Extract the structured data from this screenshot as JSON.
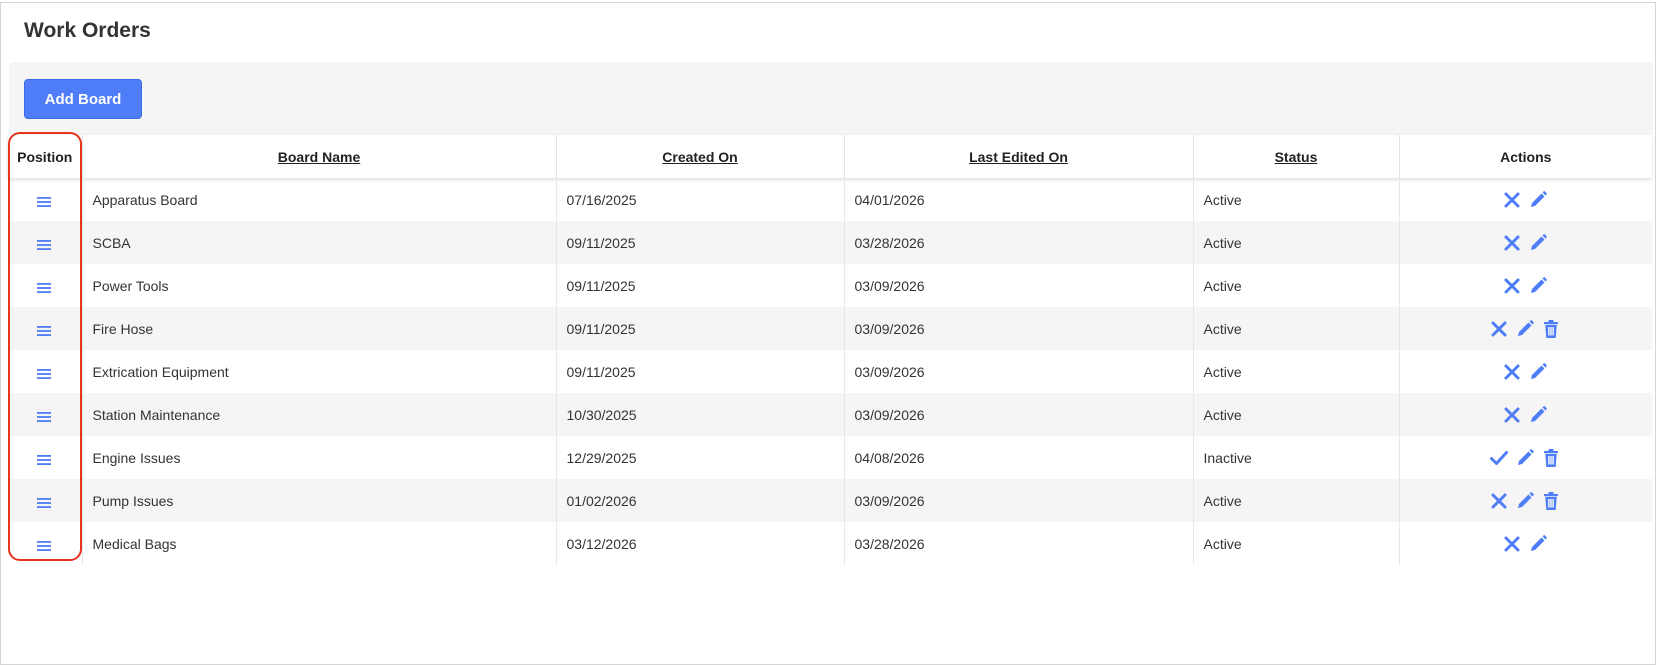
{
  "page": {
    "title": "Work Orders"
  },
  "toolbar": {
    "add_board_label": "Add Board"
  },
  "table": {
    "headers": {
      "position": "Position",
      "board_name": "Board Name",
      "created_on": "Created On",
      "last_edited_on": "Last Edited On",
      "status": "Status",
      "actions": "Actions"
    },
    "rows": [
      {
        "name": "Apparatus Board",
        "created": "07/16/2025",
        "edited": "04/01/2026",
        "status": "Active",
        "actions": [
          "deactivate",
          "edit"
        ]
      },
      {
        "name": "SCBA",
        "created": "09/11/2025",
        "edited": "03/28/2026",
        "status": "Active",
        "actions": [
          "deactivate",
          "edit"
        ]
      },
      {
        "name": "Power Tools",
        "created": "09/11/2025",
        "edited": "03/09/2026",
        "status": "Active",
        "actions": [
          "deactivate",
          "edit"
        ]
      },
      {
        "name": "Fire Hose",
        "created": "09/11/2025",
        "edited": "03/09/2026",
        "status": "Active",
        "actions": [
          "deactivate",
          "edit",
          "delete"
        ]
      },
      {
        "name": "Extrication Equipment",
        "created": "09/11/2025",
        "edited": "03/09/2026",
        "status": "Active",
        "actions": [
          "deactivate",
          "edit"
        ]
      },
      {
        "name": "Station Maintenance",
        "created": "10/30/2025",
        "edited": "03/09/2026",
        "status": "Active",
        "actions": [
          "deactivate",
          "edit"
        ]
      },
      {
        "name": "Engine Issues",
        "created": "12/29/2025",
        "edited": "04/08/2026",
        "status": "Inactive",
        "actions": [
          "activate",
          "edit",
          "delete"
        ]
      },
      {
        "name": "Pump Issues",
        "created": "01/02/2026",
        "edited": "03/09/2026",
        "status": "Active",
        "actions": [
          "deactivate",
          "edit",
          "delete"
        ]
      },
      {
        "name": "Medical Bags",
        "created": "03/12/2026",
        "edited": "03/28/2026",
        "status": "Active",
        "actions": [
          "deactivate",
          "edit"
        ]
      }
    ]
  },
  "icons": {
    "drag": "drag-handle-icon",
    "deactivate": "close-icon",
    "activate": "check-icon",
    "edit": "pencil-icon",
    "delete": "trash-icon"
  },
  "colors": {
    "accent": "#4f7cf7",
    "highlight": "#e8341f"
  }
}
